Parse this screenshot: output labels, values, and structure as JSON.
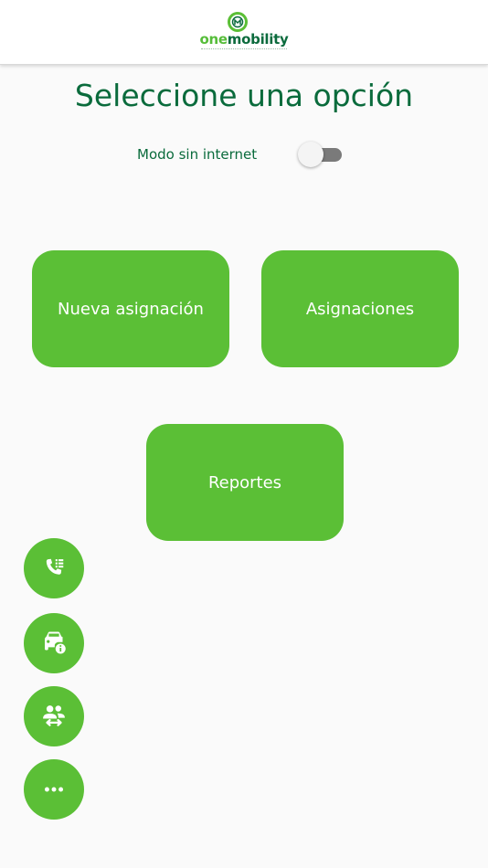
{
  "header": {
    "logo": {
      "one": "one",
      "mobility": "mobility"
    }
  },
  "main": {
    "title": "Seleccione una opción",
    "offline_toggle": {
      "label": "Modo sin internet",
      "state": "off"
    },
    "buttons": {
      "new_assignment": "Nueva asignación",
      "assignments": "Asignaciones",
      "reports": "Reportes"
    }
  },
  "fab_menu": [
    {
      "icon": "phone-list-icon"
    },
    {
      "icon": "car-info-icon"
    },
    {
      "icon": "people-swap-icon"
    },
    {
      "icon": "more-horizontal-icon"
    }
  ],
  "colors": {
    "brand_green": "#5bbf36",
    "brand_dark_green": "#0a6b3c",
    "background": "#fafafa",
    "toggle_track": "#7a7a7a"
  }
}
